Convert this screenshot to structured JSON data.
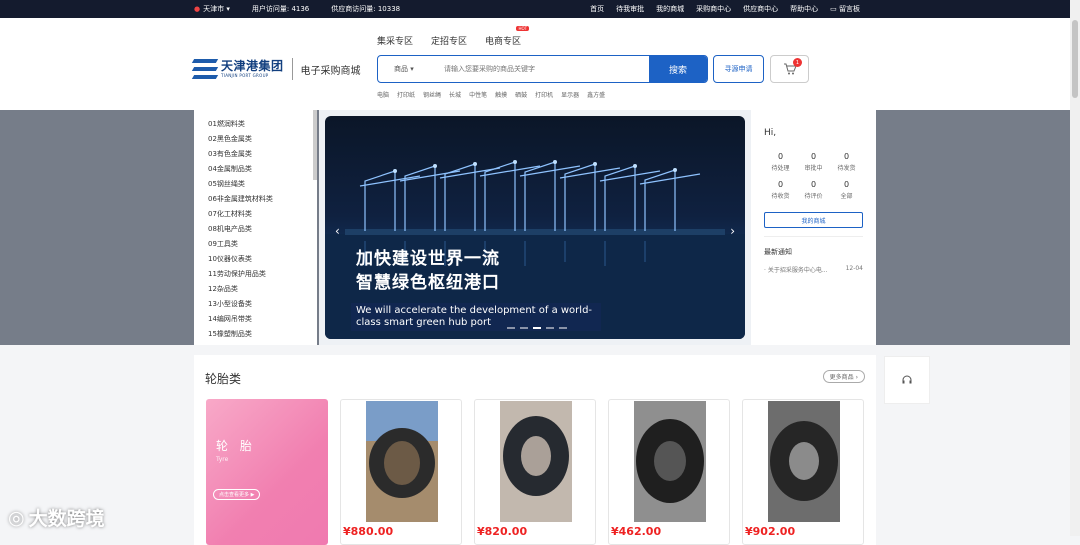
{
  "topbar": {
    "city": "天津市",
    "visits": "用户访问量: 4136",
    "supplier_visits": "供应商访问量: 10338",
    "nav": [
      "首页",
      "待我审批",
      "我的商城",
      "采购商中心",
      "供应商中心",
      "帮助中心",
      "留言板"
    ]
  },
  "header": {
    "logo_cn": "天津港集团",
    "logo_en": "TIANJIN PORT GROUP",
    "site_name": "电子采购商城",
    "zones": [
      "集采专区",
      "定招专区",
      "电商专区"
    ],
    "hot_badge": "HOT",
    "search_category": "商品",
    "search_placeholder": "请输入您要采购的商品关键字",
    "search_button": "搜索",
    "request_button": "寻源申请",
    "cart_count": "1",
    "hot_words": [
      "电脑",
      "打印纸",
      "钢丝绳",
      "长城",
      "中性笔",
      "触摸",
      "硒鼓",
      "打印机",
      "显示器",
      "鑫方盛"
    ]
  },
  "categories": [
    "01燃润料类",
    "02黑色金属类",
    "03有色金属类",
    "04金属制品类",
    "05钢丝绳类",
    "06非金属建筑材料类",
    "07化工材料类",
    "08机电产品类",
    "09工具类",
    "10仪器仪表类",
    "11劳动保护用品类",
    "12杂品类",
    "13小型设备类",
    "14编网吊带类",
    "15橡塑制品类"
  ],
  "banner": {
    "line1": "加快建设世界一流",
    "line2": "智慧绿色枢纽港口",
    "english": "We will accelerate the development of a world-class smart green hub port"
  },
  "user": {
    "greeting": "Hi,",
    "stats": [
      {
        "n": "0",
        "label": "待处理"
      },
      {
        "n": "0",
        "label": "审批中"
      },
      {
        "n": "0",
        "label": "待发货"
      },
      {
        "n": "0",
        "label": "待收货"
      },
      {
        "n": "0",
        "label": "待评价"
      },
      {
        "n": "0",
        "label": "全部"
      }
    ],
    "mall_button": "我的商城",
    "notice_title": "最新通知",
    "notice_text": "· 关于招采服务中心电...",
    "notice_date": "12-04"
  },
  "section": {
    "title": "轮胎类",
    "more": "更多商品",
    "promo_title": "轮 胎",
    "promo_sub": "Tyre",
    "promo_button": "点击查看更多",
    "prices": [
      "¥880.00",
      "¥820.00",
      "¥462.00",
      "¥902.00"
    ]
  },
  "watermark": "大数跨境"
}
